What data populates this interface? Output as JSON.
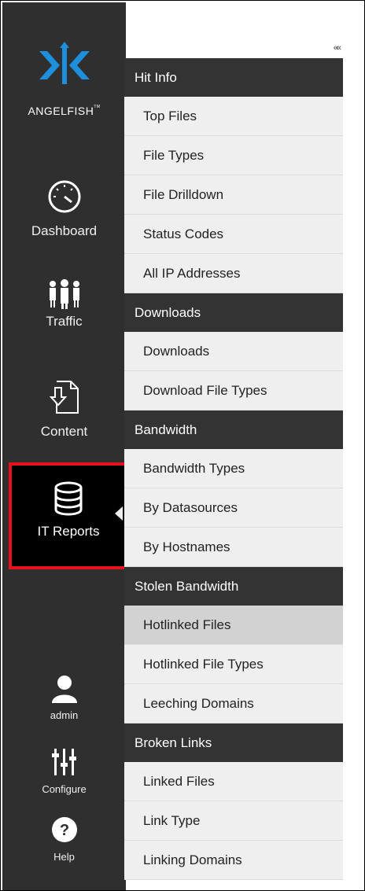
{
  "app": {
    "name": "ANGELFISH",
    "tm": "TM"
  },
  "colors": {
    "sidebar": "#2f2f2f",
    "active_bg": "#000000",
    "highlight": "#e8101a",
    "logo_blue": "#1e8fdc"
  },
  "leftnav": {
    "dashboard": "Dashboard",
    "traffic": "Traffic",
    "content": "Content",
    "it_reports": "IT Reports",
    "admin": "admin",
    "configure": "Configure",
    "help": "Help"
  },
  "submenu": {
    "collapse_icon": "««",
    "sections": [
      {
        "title": "Hit Info",
        "items": [
          "Top Files",
          "File Types",
          "File Drilldown",
          "Status Codes",
          "All IP Addresses"
        ]
      },
      {
        "title": "Downloads",
        "items": [
          "Downloads",
          "Download File Types"
        ]
      },
      {
        "title": "Bandwidth",
        "items": [
          "Bandwidth Types",
          "By Datasources",
          "By Hostnames"
        ]
      },
      {
        "title": "Stolen Bandwidth",
        "items": [
          "Hotlinked Files",
          "Hotlinked File Types",
          "Leeching Domains"
        ]
      },
      {
        "title": "Broken Links",
        "items": [
          "Linked Files",
          "Link Type",
          "Linking Domains"
        ]
      }
    ],
    "selected": "Hotlinked Files"
  }
}
